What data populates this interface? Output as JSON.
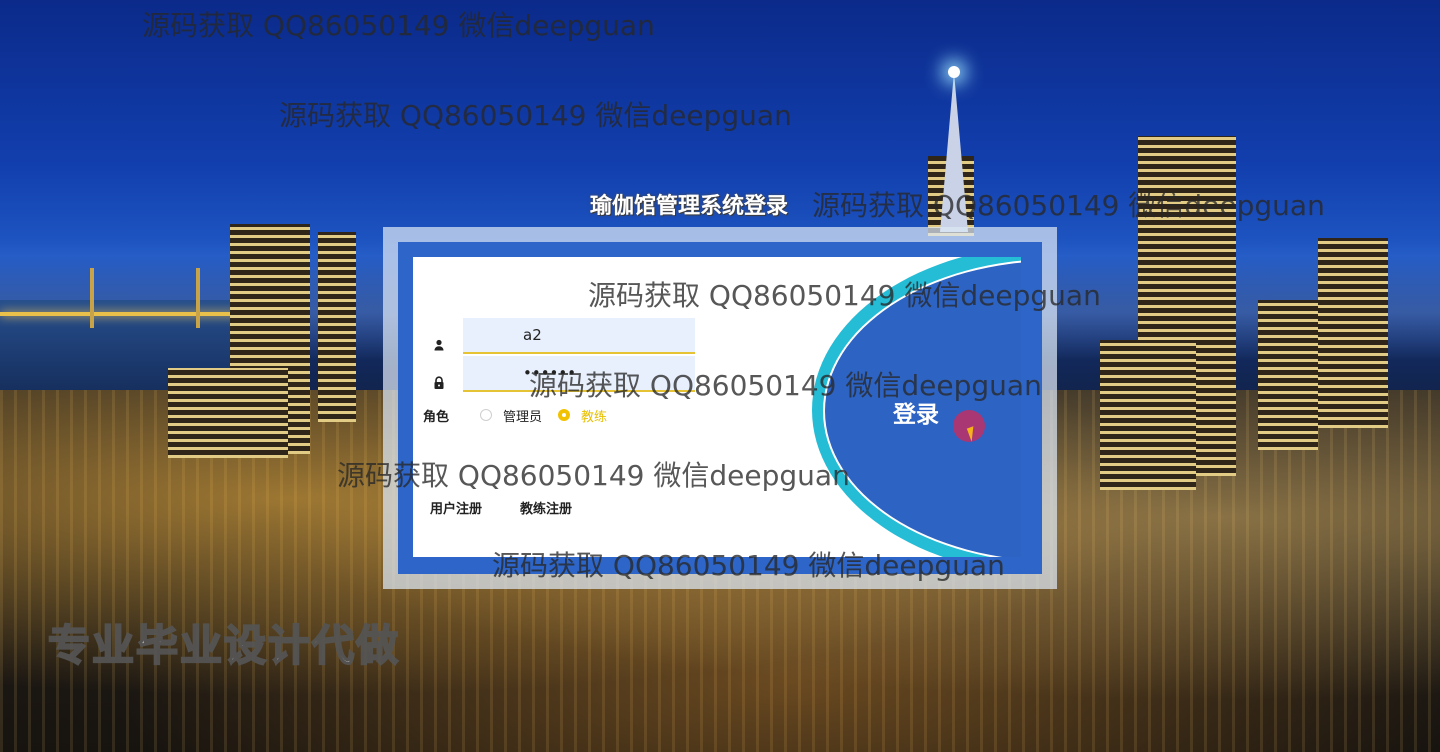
{
  "page": {
    "system_title": "瑜伽馆管理系统登录",
    "ad_text": "专业毕业设计代做"
  },
  "watermarks": [
    "源码获取 QQ86050149 微信deepguan",
    "源码获取 QQ86050149 微信deepguan",
    "源码获取 QQ86050149 微信deepguan",
    "源码获取 QQ86050149 微信deepguan",
    "源码获取 QQ86050149 微信deepguan",
    "源码获取 QQ86050149 微信deepguan",
    "源码获取 QQ86050149 微信deepguan"
  ],
  "login": {
    "username_value": "a2",
    "password_value": "••••••",
    "role_label": "角色",
    "roles": [
      {
        "label": "管理员",
        "selected": false
      },
      {
        "label": "教练",
        "selected": true
      }
    ],
    "login_button": "登录",
    "links": [
      "用户注册",
      "教练注册"
    ]
  },
  "colors": {
    "panel_border": "#2d66c8",
    "accent_ring": "#25bcd6",
    "selected_role": "#f2c200",
    "field_underline": "#e5c334"
  },
  "icons": {
    "username": "user-icon",
    "password": "lock-icon"
  }
}
